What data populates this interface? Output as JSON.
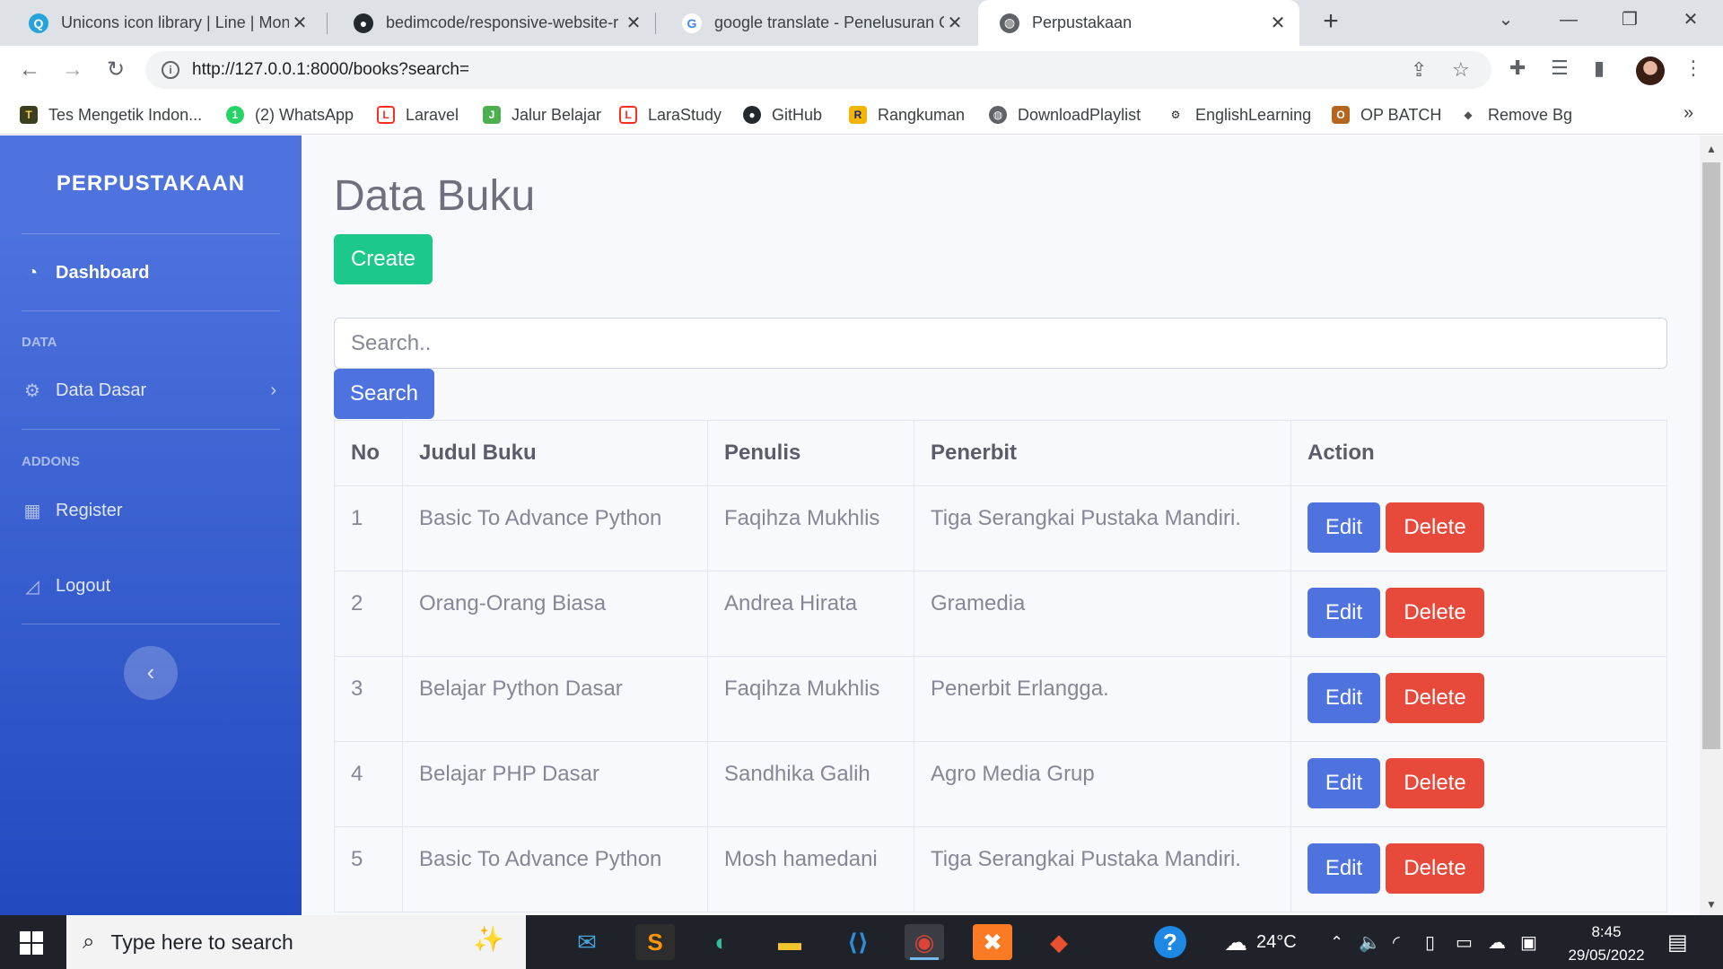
{
  "browser": {
    "tabs": [
      {
        "title": "Unicons icon library | Line | Monc",
        "favicon": "unicons-icon",
        "active": false
      },
      {
        "title": "bedimcode/responsive-website-r",
        "favicon": "github-icon",
        "active": false
      },
      {
        "title": "google translate - Penelusuran G",
        "favicon": "google-icon",
        "active": false
      },
      {
        "title": "Perpustakaan",
        "favicon": "globe-icon",
        "active": true
      }
    ],
    "new_tab_label": "+",
    "url": "http://127.0.0.1:8000/books?search=",
    "bookmarks": [
      {
        "label": "Tes Mengetik Indon...",
        "icon": "typing-test-icon",
        "color": "#3d3d1f"
      },
      {
        "label": "(2) WhatsApp",
        "icon": "whatsapp-icon",
        "color": "#25d366"
      },
      {
        "label": "Laravel",
        "icon": "laravel-icon",
        "color": "#ff2d20"
      },
      {
        "label": "Jalur Belajar",
        "icon": "jalur-belajar-icon",
        "color": "#4caf50"
      },
      {
        "label": "LaraStudy",
        "icon": "larastudy-icon",
        "color": "#ff2d20"
      },
      {
        "label": "GitHub",
        "icon": "github-icon",
        "color": "#24292e"
      },
      {
        "label": "Rangkuman",
        "icon": "rangkuman-icon",
        "color": "#f4b400"
      },
      {
        "label": "DownloadPlaylist",
        "icon": "globe-icon",
        "color": "#5f6368"
      },
      {
        "label": "EnglishLearning",
        "icon": "bike-icon",
        "color": "#202124"
      },
      {
        "label": "OP BATCH",
        "icon": "op-batch-icon",
        "color": "#b5651d"
      },
      {
        "label": "Remove Bg",
        "icon": "remove-bg-icon",
        "color": "#555555"
      }
    ],
    "bookmarks_more": "»"
  },
  "sidebar": {
    "brand": "PERPUSTAKAAN",
    "dashboard": "Dashboard",
    "heading_data": "DATA",
    "data_dasar": "Data Dasar",
    "heading_addons": "ADDONS",
    "register": "Register",
    "logout": "Logout",
    "toggle": "‹"
  },
  "main": {
    "title": "Data Buku",
    "create_label": "Create",
    "search_placeholder": "Search..",
    "search_value": "",
    "search_label": "Search",
    "columns": [
      "No",
      "Judul Buku",
      "Penulis",
      "Penerbit",
      "Action"
    ],
    "rows": [
      {
        "no": "1",
        "judul": "Basic To Advance Python",
        "penulis": "Faqihza Mukhlis",
        "penerbit": "Tiga Serangkai Pustaka Mandiri."
      },
      {
        "no": "2",
        "judul": "Orang-Orang Biasa",
        "penulis": "Andrea Hirata",
        "penerbit": "Gramedia"
      },
      {
        "no": "3",
        "judul": "Belajar Python Dasar",
        "penulis": "Faqihza Mukhlis",
        "penerbit": "Penerbit Erlangga."
      },
      {
        "no": "4",
        "judul": "Belajar PHP Dasar",
        "penulis": "Sandhika Galih",
        "penerbit": "Agro Media Grup"
      },
      {
        "no": "5",
        "judul": "Basic To Advance Python",
        "penulis": "Mosh hamedani",
        "penerbit": "Tiga Serangkai Pustaka Mandiri."
      }
    ],
    "edit_label": "Edit",
    "delete_label": "Delete"
  },
  "taskbar": {
    "search_placeholder": "Type here to search",
    "weather": "24°C",
    "time": "8:45",
    "date": "29/05/2022"
  },
  "colors": {
    "primary": "#4e73df",
    "success": "#1cc88a",
    "danger": "#e74a3b"
  }
}
